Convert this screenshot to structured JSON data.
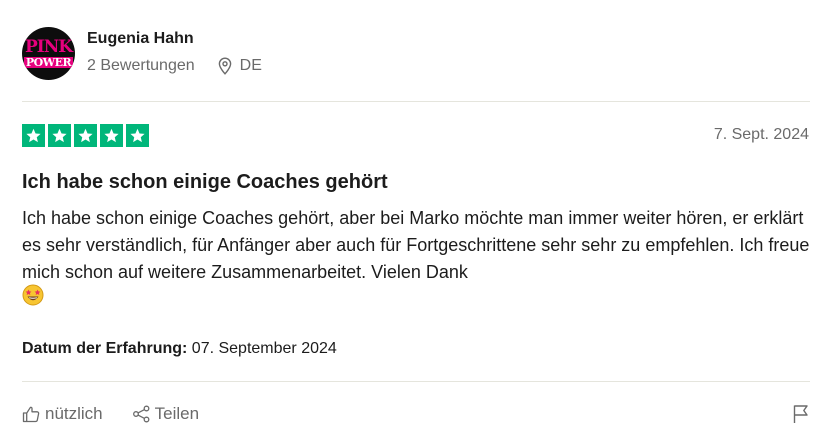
{
  "user": {
    "name": "Eugenia Hahn",
    "reviews": "2 Bewertungen",
    "country": "DE",
    "avatar_text_top": "PINK",
    "avatar_text_bottom": "POWER"
  },
  "review": {
    "rating": 5,
    "rating_max": 5,
    "date": "7. Sept. 2024",
    "title": "Ich habe schon einige Coaches gehört",
    "body": "Ich habe schon einige Coaches gehört, aber bei Marko möchte man immer weiter hören, er erklärt es sehr verständlich, für Anfänger aber auch für Fortgeschrittene sehr sehr zu empfehlen. Ich freue mich schon auf weitere Zusammenarbeitet. Vielen Dank",
    "experience_label": "Datum der Erfahrung:",
    "experience_date": "07. September 2024"
  },
  "actions": {
    "useful_label": "nützlich",
    "share_label": "Teilen"
  },
  "colors": {
    "star_green": "#00b67a",
    "avatar_pink": "#e6007e",
    "muted_text": "#6a6a6a"
  },
  "icons": [
    "location-pin-icon",
    "star-icon",
    "grinning-star-eyes-emoji",
    "thumbs-up-icon",
    "share-icon",
    "flag-icon"
  ]
}
